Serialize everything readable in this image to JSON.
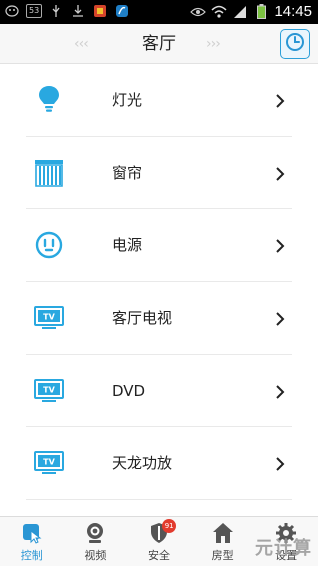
{
  "status_bar": {
    "badge": "53",
    "time": "14:45"
  },
  "header": {
    "title": "客厅",
    "left_arrows": "‹‹‹",
    "right_arrows": "›››"
  },
  "devices": [
    {
      "label": "灯光",
      "icon": "bulb-icon"
    },
    {
      "label": "窗帘",
      "icon": "curtain-icon"
    },
    {
      "label": "电源",
      "icon": "power-icon"
    },
    {
      "label": "客厅电视",
      "icon": "tv-icon"
    },
    {
      "label": "DVD",
      "icon": "tv-icon"
    },
    {
      "label": "天龙功放",
      "icon": "tv-icon"
    }
  ],
  "tabs": [
    {
      "label": "控制",
      "icon": "control-icon",
      "active": true
    },
    {
      "label": "视频",
      "icon": "camera-icon"
    },
    {
      "label": "安全",
      "icon": "shield-icon",
      "badge": "91"
    },
    {
      "label": "房型",
      "icon": "house-icon"
    },
    {
      "label": "设置",
      "icon": "gear-icon"
    }
  ],
  "watermark": "元计算",
  "colors": {
    "accent": "#2a96d4",
    "icon_blue": "#29a8e0",
    "badge_red": "#e23b2e"
  }
}
